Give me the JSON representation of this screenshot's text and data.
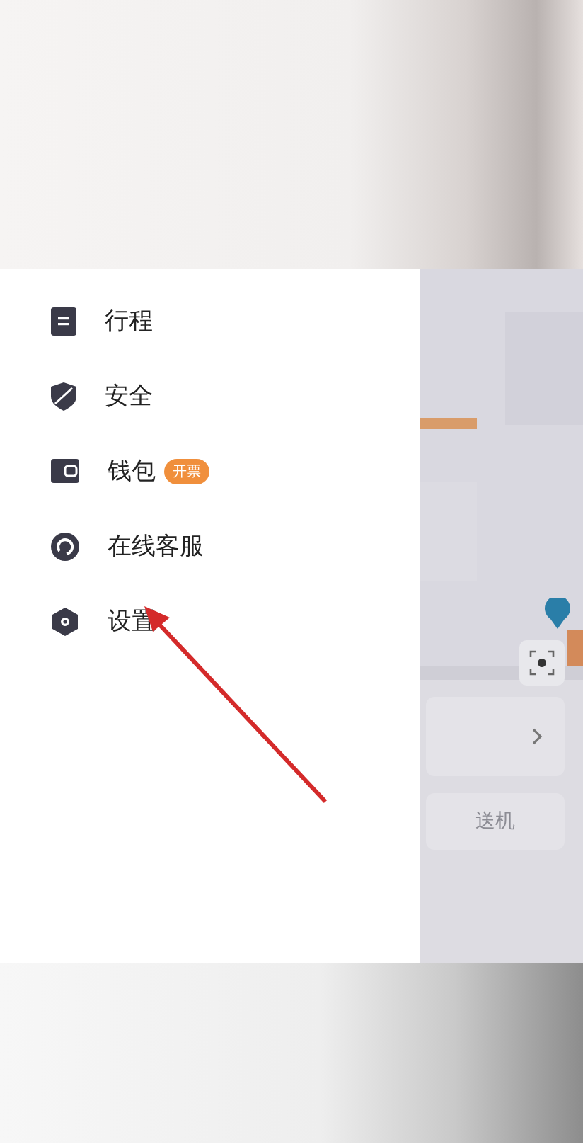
{
  "menu": [
    {
      "kind": "itinerary",
      "label": "行程"
    },
    {
      "kind": "security",
      "label": "安全"
    },
    {
      "kind": "wallet",
      "label": "钱包",
      "badge": "开票"
    },
    {
      "kind": "service",
      "label": "在线客服"
    },
    {
      "kind": "settings",
      "label": "设置"
    }
  ],
  "map_panel": {
    "service_label": "送机"
  }
}
